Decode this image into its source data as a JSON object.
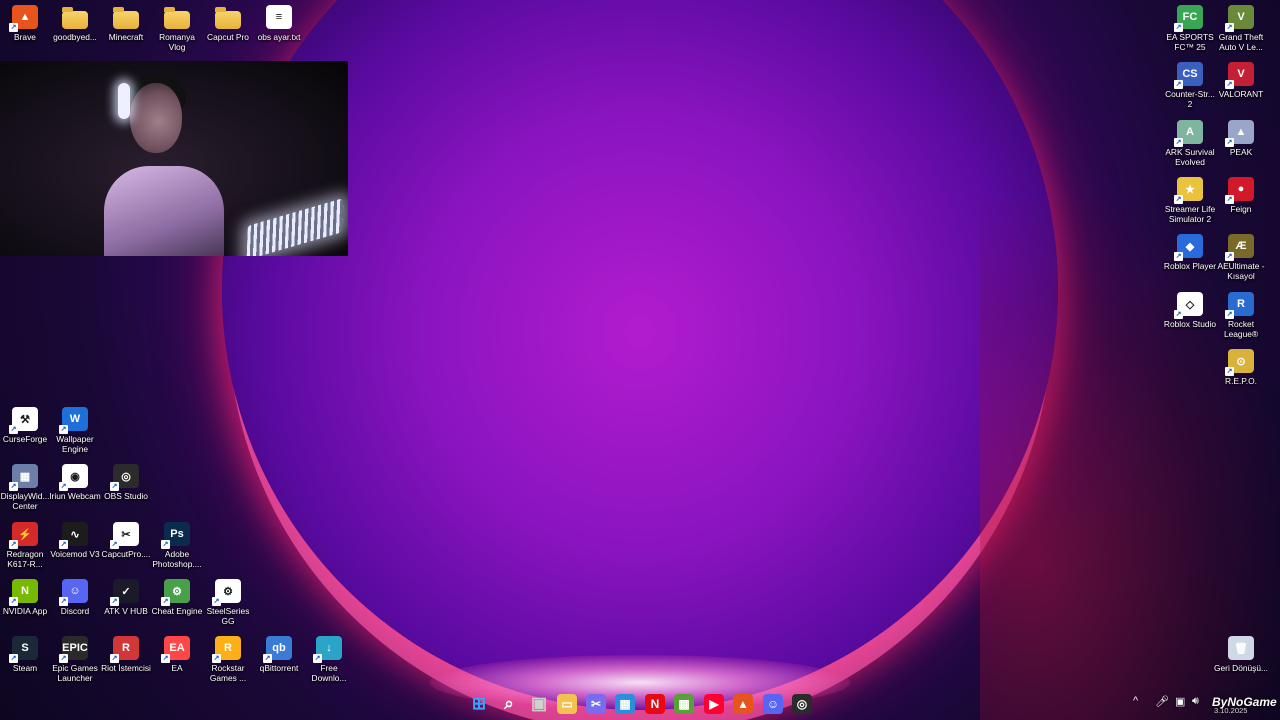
{
  "desktop": {
    "top_left_icons": [
      {
        "label": "Brave",
        "icon": "brave-icon",
        "color": "#e8541d"
      },
      {
        "label": "goodbyed...",
        "icon": "folder-icon",
        "color": "#f2c14e"
      },
      {
        "label": "Minecraft",
        "icon": "folder-icon",
        "color": "#f2c14e"
      },
      {
        "label": "Romanya Vlog",
        "icon": "folder-icon",
        "color": "#f2c14e"
      },
      {
        "label": "Capcut Pro",
        "icon": "folder-icon",
        "color": "#f2c14e"
      },
      {
        "label": "obs ayar.txt",
        "icon": "text-file-icon",
        "color": "#ffffff"
      }
    ],
    "right_icons": [
      {
        "label": "EA SPORTS FC™ 25",
        "icon": "ea-fc-icon",
        "color": "#3aa655"
      },
      {
        "label": "Grand Theft Auto V Le...",
        "icon": "gta-icon",
        "color": "#6a8a3a"
      },
      {
        "label": "Counter-Str... 2",
        "icon": "counter-strike-icon",
        "color": "#3b5fbf"
      },
      {
        "label": "VALORANT",
        "icon": "valorant-icon",
        "color": "#c41f35"
      },
      {
        "label": "ARK Survival Evolved",
        "icon": "ark-icon",
        "color": "#7fb4a0"
      },
      {
        "label": "PEAK",
        "icon": "peak-icon",
        "color": "#9aa6c9"
      },
      {
        "label": "Streamer Life Simulator 2",
        "icon": "streamer-life-icon",
        "color": "#e9c33b"
      },
      {
        "label": "Feign",
        "icon": "feign-icon",
        "color": "#d2192a"
      },
      {
        "label": "Roblox Player",
        "icon": "roblox-icon",
        "color": "#2a6bdc"
      },
      {
        "label": "AEUltimate - Kısayol",
        "icon": "aeultimate-icon",
        "color": "#7a6a2a"
      },
      {
        "label": "Roblox Studio",
        "icon": "roblox-studio-icon",
        "color": "#ffffff"
      },
      {
        "label": "Rocket League®",
        "icon": "rocket-league-icon",
        "color": "#2a6bd0"
      },
      {
        "label": "R.E.P.O.",
        "icon": "repo-icon",
        "color": "#d8b23a"
      }
    ],
    "bottom_left_icons": [
      {
        "label": "CurseForge",
        "icon": "curseforge-icon",
        "color": "#ffffff"
      },
      {
        "label": "Wallpaper Engine",
        "icon": "wallpaper-engine-icon",
        "color": "#1e6fd9"
      },
      {
        "label": "DisplayWid... Center",
        "icon": "displaywidget-icon",
        "color": "#6b7fa8"
      },
      {
        "label": "Iriun Webcam",
        "icon": "iriun-webcam-icon",
        "color": "#ffffff"
      },
      {
        "label": "OBS Studio",
        "icon": "obs-icon",
        "color": "#2b2b2b"
      },
      {
        "label": "Redragon K617-R...",
        "icon": "redragon-icon",
        "color": "#d42a2a"
      },
      {
        "label": "Voicemod V3",
        "icon": "voicemod-icon",
        "color": "#1c1c1c"
      },
      {
        "label": "CapcutPro....",
        "icon": "capcut-icon",
        "color": "#ffffff"
      },
      {
        "label": "Adobe Photoshop....",
        "icon": "photoshop-icon",
        "color": "#0b2b4d"
      },
      {
        "label": "NVIDIA App",
        "icon": "nvidia-icon",
        "color": "#76b900"
      },
      {
        "label": "Discord",
        "icon": "discord-icon",
        "color": "#5865f2"
      },
      {
        "label": "ATK V HUB",
        "icon": "atk-hub-icon",
        "color": "#1a1a2a"
      },
      {
        "label": "Cheat Engine",
        "icon": "cheat-engine-icon",
        "color": "#4aa04a"
      },
      {
        "label": "SteelSeries GG",
        "icon": "steelseries-icon",
        "color": "#ffffff"
      },
      {
        "label": "Steam",
        "icon": "steam-icon",
        "color": "#1b2838"
      },
      {
        "label": "Epic Games Launcher",
        "icon": "epic-games-icon",
        "color": "#2a2a2a"
      },
      {
        "label": "Riot İstemcisi",
        "icon": "riot-client-icon",
        "color": "#d13639"
      },
      {
        "label": "EA",
        "icon": "ea-icon",
        "color": "#ff4747"
      },
      {
        "label": "Rockstar Games ...",
        "icon": "rockstar-icon",
        "color": "#fcaf17"
      },
      {
        "label": "qBittorrent",
        "icon": "qbittorrent-icon",
        "color": "#3a7bd5"
      },
      {
        "label": "Free Downlo...",
        "icon": "free-download-manager-icon",
        "color": "#2aa5c8"
      }
    ],
    "recycle_bin": {
      "label": "Geri Dönüşü...",
      "icon": "recycle-bin-icon"
    }
  },
  "taskbar": {
    "icons": [
      {
        "name": "start-icon",
        "color": "#3aa0ff"
      },
      {
        "name": "search-icon",
        "color": "#ffffff"
      },
      {
        "name": "task-view-icon",
        "color": "#d0d0d0"
      },
      {
        "name": "file-explorer-icon",
        "color": "#f2c14e"
      },
      {
        "name": "snipping-tool-icon",
        "color": "#7a6cf0"
      },
      {
        "name": "microsoft-store-icon",
        "color": "#2a8de0"
      },
      {
        "name": "netflix-icon",
        "color": "#e50914"
      },
      {
        "name": "minecraft-icon",
        "color": "#5aa03a"
      },
      {
        "name": "youtube-music-icon",
        "color": "#ff0033"
      },
      {
        "name": "brave-icon",
        "color": "#e8541d"
      },
      {
        "name": "discord-icon",
        "color": "#5865f2"
      },
      {
        "name": "obs-icon",
        "color": "#2b2b2b"
      }
    ],
    "tray": {
      "chevron": "^",
      "watermark": "ByNoGame",
      "date": "3.10.2025"
    }
  }
}
